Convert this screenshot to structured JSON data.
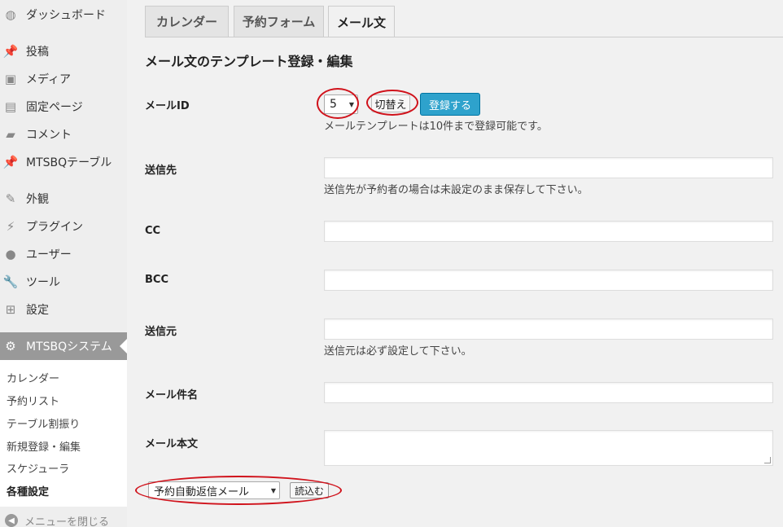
{
  "sidebar": {
    "items": [
      {
        "icon": "dashboard-icon",
        "glyph": "◍",
        "label": "ダッシュボード"
      },
      {
        "icon": "pin-icon",
        "glyph": "📌",
        "label": "投稿"
      },
      {
        "icon": "media-icon",
        "glyph": "▣",
        "label": "メディア"
      },
      {
        "icon": "page-icon",
        "glyph": "▤",
        "label": "固定ページ"
      },
      {
        "icon": "comment-icon",
        "glyph": "▰",
        "label": "コメント"
      },
      {
        "icon": "pin-icon",
        "glyph": "📌",
        "label": "MTSBQテーブル"
      },
      {
        "icon": "brush-icon",
        "glyph": "✎",
        "label": "外観"
      },
      {
        "icon": "plugin-icon",
        "glyph": "⚡",
        "label": "プラグイン"
      },
      {
        "icon": "user-icon",
        "glyph": "●",
        "label": "ユーザー"
      },
      {
        "icon": "wrench-icon",
        "glyph": "🔧",
        "label": "ツール"
      },
      {
        "icon": "settings-icon",
        "glyph": "⊞",
        "label": "設定"
      },
      {
        "icon": "gear-icon",
        "glyph": "⚙",
        "label": "MTSBQシステム"
      }
    ],
    "submenu": [
      "カレンダー",
      "予約リスト",
      "テーブル割振り",
      "新規登録・編集",
      "スケジューラ",
      "各種設定"
    ],
    "collapse_label": "メニューを閉じる",
    "collapse_glyph": "◀"
  },
  "tabs": [
    "カレンダー",
    "予約フォーム",
    "メール文"
  ],
  "page_title": "メール文のテンプレート登録・編集",
  "form": {
    "mail_id": {
      "label": "メールID",
      "value": "5",
      "switch_label": "切替え",
      "register_label": "登録する",
      "help": "メールテンプレートは10件まで登録可能です。"
    },
    "to": {
      "label": "送信先",
      "value": "",
      "help": "送信先が予約者の場合は未設定のまま保存して下さい。"
    },
    "cc": {
      "label": "CC",
      "value": ""
    },
    "bcc": {
      "label": "BCC",
      "value": ""
    },
    "from": {
      "label": "送信元",
      "value": "",
      "help": "送信元は必ず設定して下さい。"
    },
    "subject": {
      "label": "メール件名",
      "value": ""
    },
    "body": {
      "label": "メール本文",
      "value": ""
    }
  },
  "template_loader": {
    "selected": "予約自動返信メール",
    "load_label": "読込む"
  },
  "colors": {
    "annotation": "#d0121b",
    "primary_button": "#2ea2cc"
  }
}
